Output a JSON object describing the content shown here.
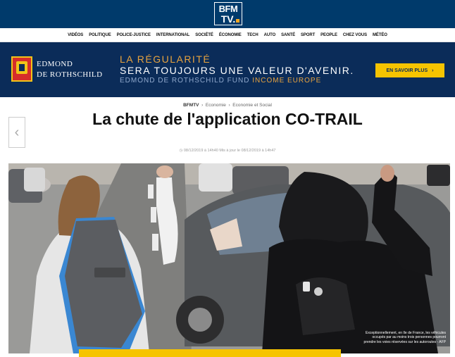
{
  "header": {
    "logo_line1": "BFM",
    "logo_line2": "TV."
  },
  "nav": {
    "items": [
      "VIDÉOS",
      "POLITIQUE",
      "POLICE-JUSTICE",
      "INTERNATIONAL",
      "SOCIÉTÉ",
      "ÉCONOMIE",
      "TECH",
      "AUTO",
      "SANTÉ",
      "SPORT",
      "PEOPLE",
      "CHEZ VOUS",
      "MÉTÉO"
    ]
  },
  "ad": {
    "brand_line1": "EDMOND",
    "brand_line2": "DE ROTHSCHILD",
    "line1": "LA RÉGULARITÉ",
    "line2": "SERA TOUJOURS UNE VALEUR D'AVENIR.",
    "line3_prefix": "EDMOND DE ROTHSCHILD FUND ",
    "line3_highlight": "INCOME EUROPE",
    "button_label": "EN SAVOIR PLUS",
    "button_chevron": "›",
    "colors": {
      "background": "#0b2c59",
      "accent": "#e8a33e",
      "button": "#f6c400"
    }
  },
  "article": {
    "breadcrumb": [
      "BFMTV",
      "Economie",
      "Economie et Social"
    ],
    "breadcrumb_sep": "›",
    "title": "La chute de l'application CO-TRAIL",
    "date": "08/12/2019 à 14h40 Mis à jour le 08/12/2019 à 14h47",
    "clock_icon": "clock-icon",
    "prev_arrow": "‹",
    "photo_caption": "Exceptionnellement, en Ile de France, les véhicules occupés par au moins trois personnes pourront prendre les voies réservées sur les autoroutes - AFP"
  },
  "theme": {
    "header_bg": "#003a6b",
    "accent": "#f6c400"
  }
}
